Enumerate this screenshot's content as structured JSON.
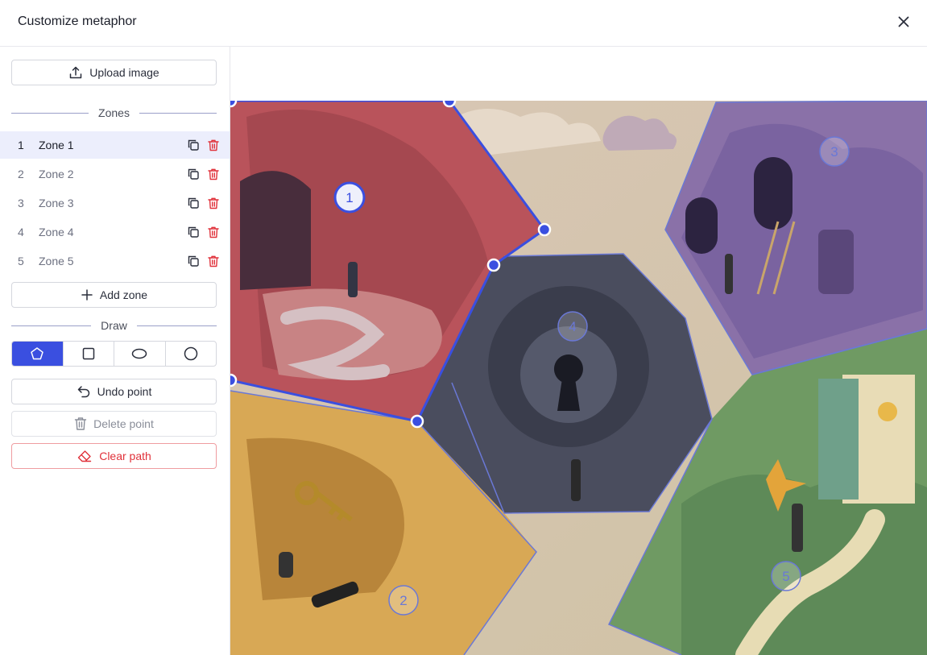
{
  "dialog": {
    "title": "Customize metaphor"
  },
  "sidebar": {
    "upload_label": "Upload image",
    "zones_heading": "Zones",
    "zones": [
      {
        "num": "1",
        "name": "Zone 1",
        "active": true
      },
      {
        "num": "2",
        "name": "Zone 2",
        "active": false
      },
      {
        "num": "3",
        "name": "Zone 3",
        "active": false
      },
      {
        "num": "4",
        "name": "Zone 4",
        "active": false
      },
      {
        "num": "5",
        "name": "Zone 5",
        "active": false
      }
    ],
    "add_zone_label": "Add zone",
    "draw_heading": "Draw",
    "draw_tools": [
      {
        "name": "polygon",
        "active": true
      },
      {
        "name": "rectangle",
        "active": false
      },
      {
        "name": "ellipse",
        "active": false
      },
      {
        "name": "circle",
        "active": false
      }
    ],
    "undo_label": "Undo point",
    "delete_label": "Delete point",
    "clear_label": "Clear path"
  },
  "canvas": {
    "zone_markers": [
      "1",
      "2",
      "3",
      "4",
      "5"
    ],
    "colors": {
      "accent": "#3a4fe0",
      "danger": "#e0313a",
      "zone_outline": "#5a6ad8"
    }
  }
}
